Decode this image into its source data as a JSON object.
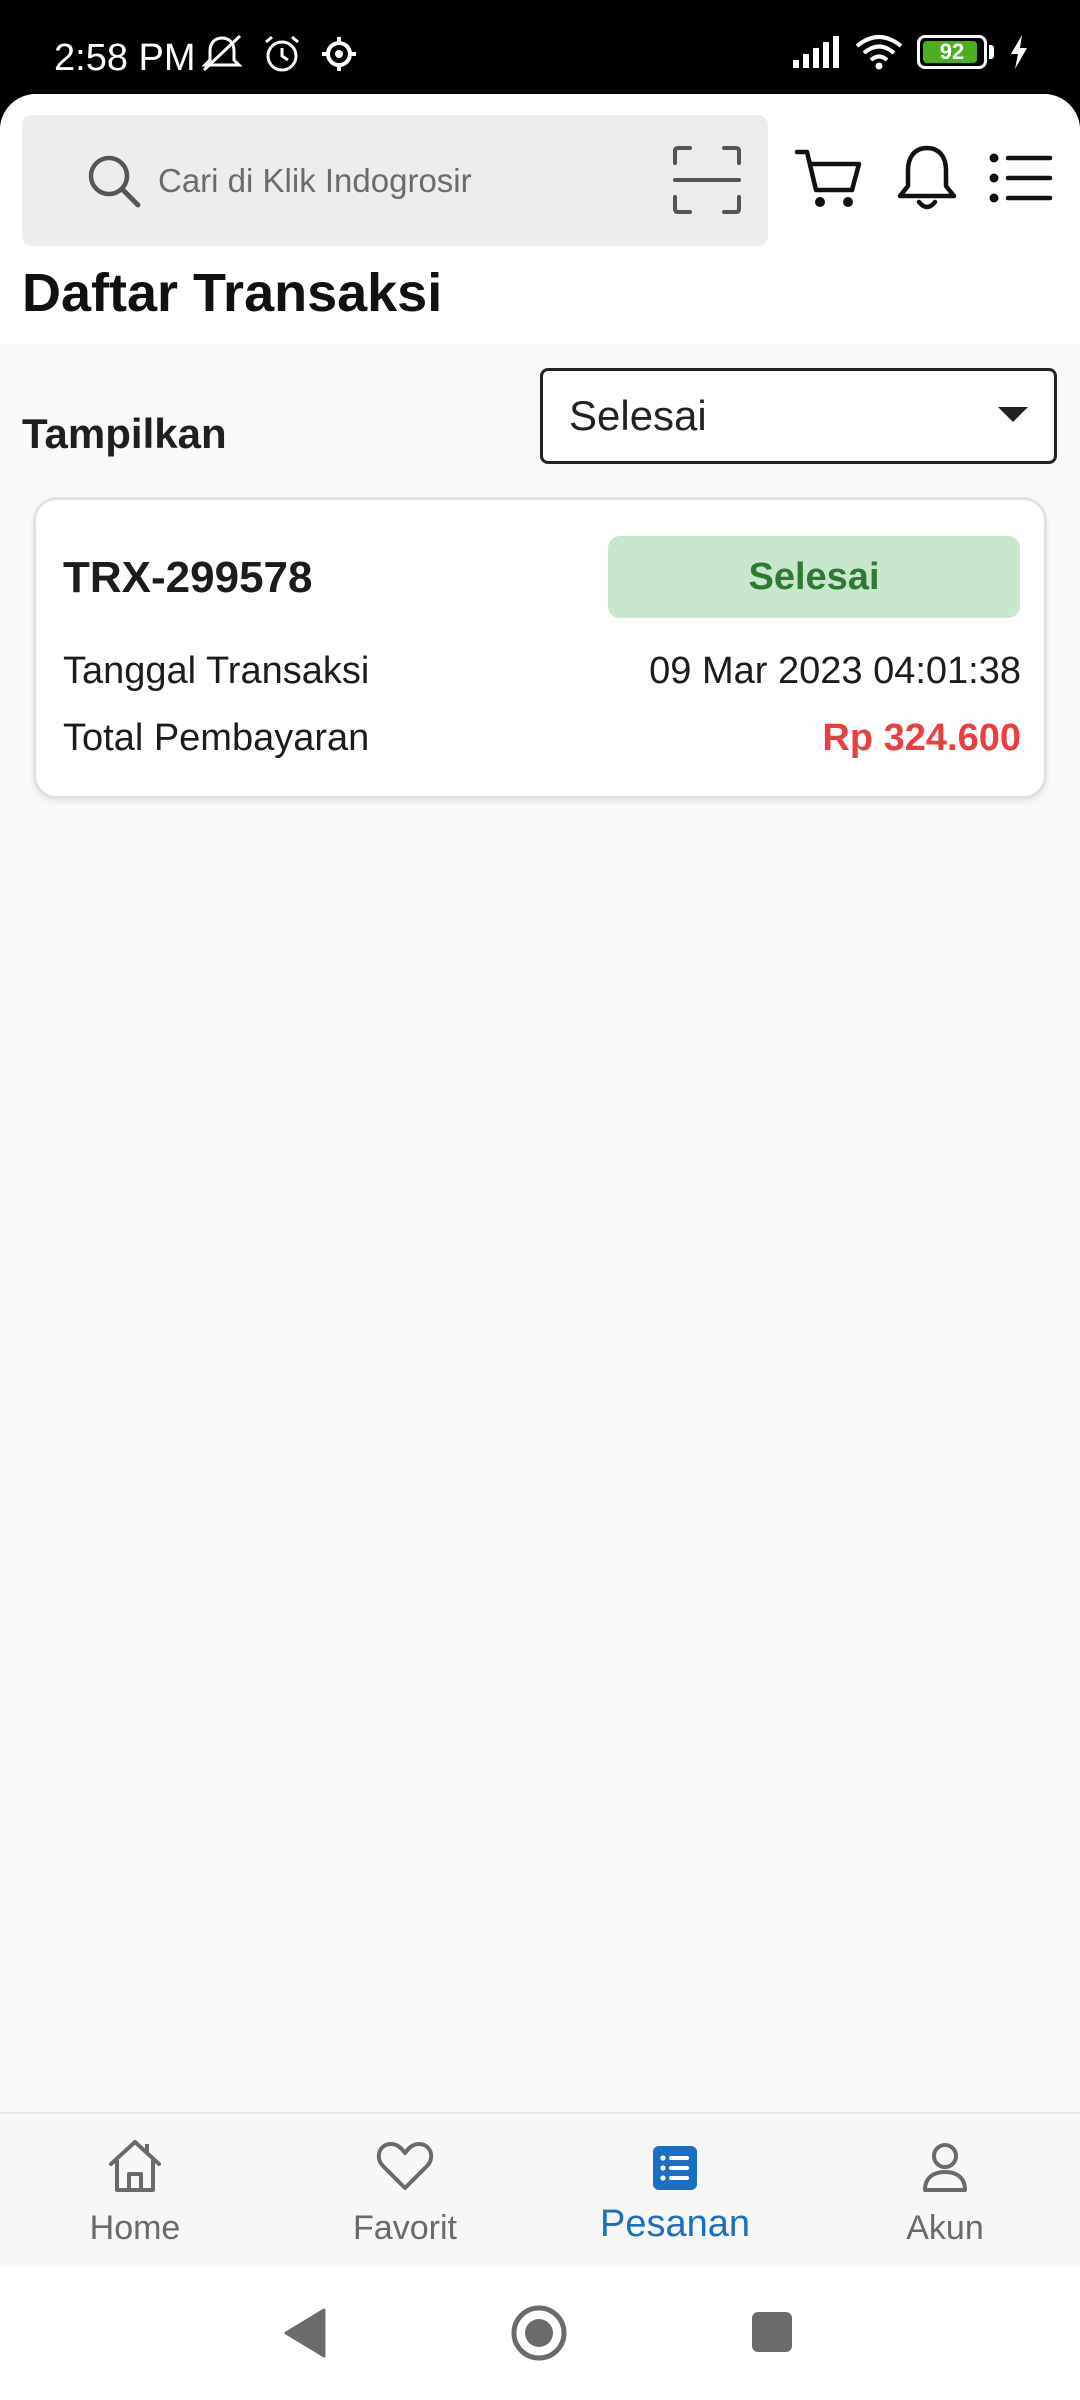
{
  "status_bar": {
    "time": "2:58 PM",
    "battery_level": "92",
    "icons": [
      "mute-icon",
      "alarm-icon",
      "settings-icon",
      "signal-icon",
      "wifi-icon",
      "battery-icon",
      "charging-icon"
    ]
  },
  "header": {
    "search_placeholder": "Cari di Klik Indogrosir",
    "icons": [
      "search-icon",
      "scan-icon",
      "cart-icon",
      "bell-icon",
      "menu-icon"
    ]
  },
  "page": {
    "title": "Daftar Transaksi"
  },
  "filter": {
    "label": "Tampilkan",
    "selected": "Selesai"
  },
  "transactions": [
    {
      "id": "TRX-299578",
      "status": "Selesai",
      "date_label": "Tanggal Transaksi",
      "date_value": "09 Mar 2023 04:01:38",
      "total_label": "Total Pembayaran",
      "total_value": "Rp 324.600"
    }
  ],
  "bottom_nav": {
    "items": [
      {
        "label": "Home",
        "icon": "home-icon"
      },
      {
        "label": "Favorit",
        "icon": "heart-icon"
      },
      {
        "label": "Pesanan",
        "icon": "orders-icon"
      },
      {
        "label": "Akun",
        "icon": "account-icon"
      }
    ],
    "active": "Pesanan"
  },
  "colors": {
    "accent_blue": "#1a6fc4",
    "status_green_bg": "#c9e7cc",
    "status_green_text": "#2f7a33",
    "price_red": "#e8403f"
  }
}
